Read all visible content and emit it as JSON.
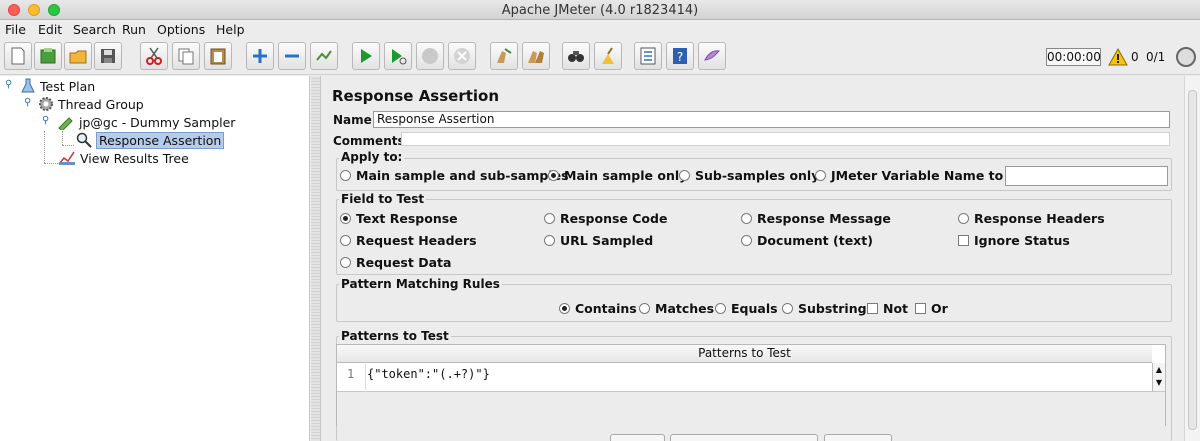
{
  "window": {
    "title": "Apache JMeter (4.0 r1823414)"
  },
  "menu": [
    {
      "label": "File"
    },
    {
      "label": "Edit"
    },
    {
      "label": "Search"
    },
    {
      "label": "Run"
    },
    {
      "label": "Options"
    },
    {
      "label": "Help"
    }
  ],
  "toolbar": {
    "icons": [
      "new-icon",
      "templates-icon",
      "open-icon",
      "save-icon",
      "cut-icon",
      "copy-icon",
      "paste-icon",
      "expand-icon",
      "collapse-icon",
      "toggle-icon",
      "start-icon",
      "start-no-pauses-icon",
      "stop-icon",
      "shutdown-icon",
      "clear-icon",
      "clear-all-icon",
      "search-icon",
      "reset-search-icon",
      "function-helper-icon",
      "help-icon",
      "remote-icon"
    ],
    "timer": "00:00:00",
    "warnings": "0",
    "threads": "0/1"
  },
  "tree": {
    "items": [
      {
        "label": "Test Plan"
      },
      {
        "label": "Thread Group"
      },
      {
        "label": "jp@gc - Dummy Sampler"
      },
      {
        "label": "Response Assertion"
      },
      {
        "label": "View Results Tree"
      }
    ]
  },
  "panel": {
    "title": "Response Assertion",
    "name_label": "Name:",
    "name_value": "Response Assertion",
    "comments_label": "Comments:",
    "apply_to": {
      "title": "Apply to:",
      "options": [
        {
          "label": "Main sample and sub-samples",
          "selected": false
        },
        {
          "label": "Main sample only",
          "selected": true
        },
        {
          "label": "Sub-samples only",
          "selected": false
        },
        {
          "label": "JMeter Variable Name to use",
          "selected": false
        }
      ],
      "variable_value": ""
    },
    "field_to_test": {
      "title": "Field to Test",
      "options": [
        {
          "label": "Text Response",
          "selected": true
        },
        {
          "label": "Response Code",
          "selected": false
        },
        {
          "label": "Response Message",
          "selected": false
        },
        {
          "label": "Response Headers",
          "selected": false
        },
        {
          "label": "Request Headers",
          "selected": false
        },
        {
          "label": "URL Sampled",
          "selected": false
        },
        {
          "label": "Document (text)",
          "selected": false
        },
        {
          "label": "Ignore Status",
          "checked": false
        },
        {
          "label": "Request Data",
          "selected": false
        }
      ]
    },
    "pattern_rules": {
      "title": "Pattern Matching Rules",
      "options": [
        {
          "label": "Contains",
          "selected": true
        },
        {
          "label": "Matches",
          "selected": false
        },
        {
          "label": "Equals",
          "selected": false
        },
        {
          "label": "Substring",
          "selected": false
        },
        {
          "label": "Not",
          "checked": false
        },
        {
          "label": "Or",
          "checked": false
        }
      ]
    },
    "patterns": {
      "title": "Patterns to Test",
      "column": "Patterns to Test",
      "rows": [
        {
          "num": "1",
          "text": "{\"token\":\"(.+?)\"}"
        }
      ],
      "scroll_up": "▲",
      "scroll_down": "▼"
    }
  }
}
